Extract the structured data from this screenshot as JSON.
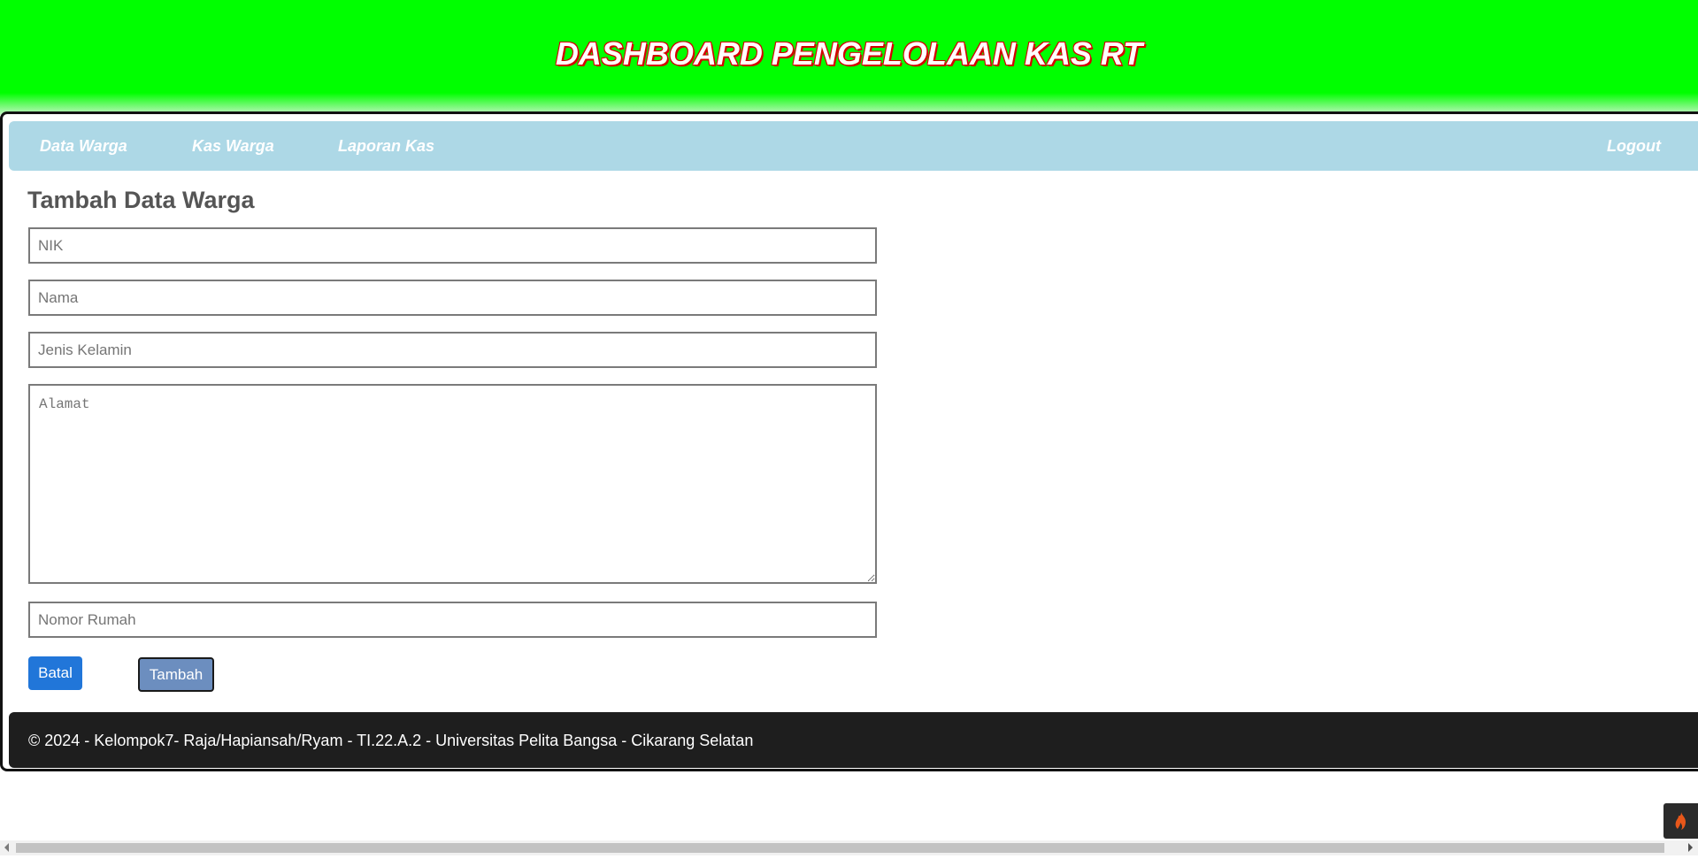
{
  "header": {
    "title": "DASHBOARD PENGELOLAAN KAS RT"
  },
  "nav": {
    "items": [
      {
        "label": "Data Warga"
      },
      {
        "label": "Kas Warga"
      },
      {
        "label": "Laporan Kas"
      }
    ],
    "logout_label": "Logout"
  },
  "form": {
    "title": "Tambah Data Warga",
    "nik_placeholder": "NIK",
    "nama_placeholder": "Nama",
    "jenis_kelamin_placeholder": "Jenis Kelamin",
    "alamat_placeholder": "Alamat",
    "nomor_rumah_placeholder": "Nomor Rumah",
    "batal_label": "Batal",
    "tambah_label": "Tambah"
  },
  "footer": {
    "text": "© 2024 - Kelompok7- Raja/Hapiansah/Ryam - TI.22.A.2 - Universitas Pelita Bangsa - Cikarang Selatan"
  },
  "floating_button": {
    "icon": "flame-icon",
    "color": "#e8571a"
  },
  "colors": {
    "header_bg": "#00ff00",
    "nav_bg": "#add8e6",
    "footer_bg": "#1e1e1e",
    "batal_bg": "#2176d9",
    "tambah_bg": "#6c8ebf"
  }
}
